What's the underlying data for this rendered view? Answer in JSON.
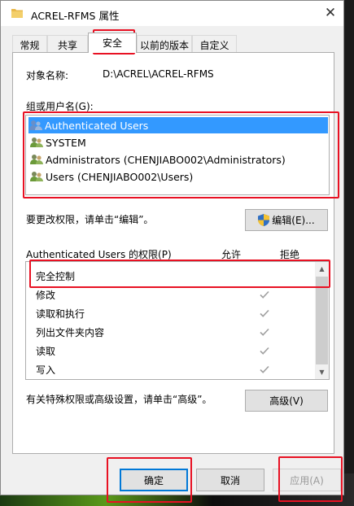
{
  "window": {
    "title": "ACREL-RFMS 属性",
    "close_glyph": "✕"
  },
  "tabs": [
    {
      "label": "常规"
    },
    {
      "label": "共享"
    },
    {
      "label": "安全"
    },
    {
      "label": "以前的版本"
    },
    {
      "label": "自定义"
    }
  ],
  "security": {
    "object_name_label": "对象名称:",
    "object_name_value": "D:\\ACREL\\ACREL-RFMS",
    "groups_label": "组或用户名(G):",
    "groups": [
      {
        "name": "Authenticated Users",
        "selected": true
      },
      {
        "name": "SYSTEM",
        "selected": false
      },
      {
        "name": "Administrators (CHENJIABO002\\Administrators)",
        "selected": false
      },
      {
        "name": "Users (CHENJIABO002\\Users)",
        "selected": false
      }
    ],
    "change_hint": "要更改权限，请单击“编辑”。",
    "edit_button": "编辑(E)...",
    "perm_header": "Authenticated Users 的权限(P)",
    "allow_header": "允许",
    "deny_header": "拒绝",
    "permissions": [
      {
        "name": "完全控制",
        "allow": false
      },
      {
        "name": "修改",
        "allow": true
      },
      {
        "name": "读取和执行",
        "allow": true
      },
      {
        "name": "列出文件夹内容",
        "allow": true
      },
      {
        "name": "读取",
        "allow": true
      },
      {
        "name": "写入",
        "allow": true
      }
    ],
    "advanced_hint": "有关特殊权限或高级设置，请单击“高级”。",
    "advanced_button": "高级(V)"
  },
  "footer": {
    "ok_button": "确定",
    "cancel_button": "取消",
    "apply_button": "应用(A)"
  },
  "colors": {
    "selection": "#3399ff",
    "highlight_annotation": "#e81123",
    "check_gray": "#a0a0a0"
  }
}
